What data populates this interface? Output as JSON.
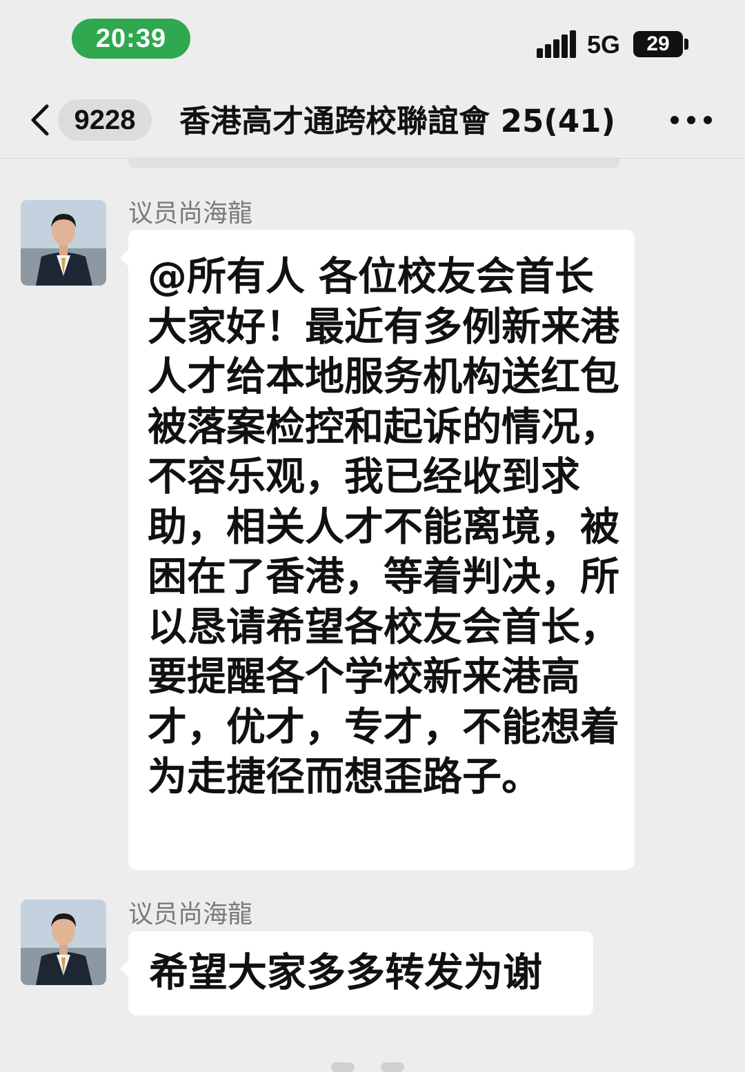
{
  "status_bar": {
    "time": "20:39",
    "network": "5G",
    "battery": "29"
  },
  "nav": {
    "unread_count": "9228",
    "title": "香港高才通跨校聯誼會 25(41)",
    "back_icon": "chevron-left-icon",
    "more_icon": "more-dots-icon"
  },
  "messages": [
    {
      "sender": "议员尚海龍",
      "text": "@所有人 各位校友会首长大家好！最近有多例新来港人才给本地服务机构送红包被落案检控和起诉的情况，不容乐观，我已经收到求助，相关人才不能离境，被困在了香港，等着判决，所以恳请希望各校友会首长，要提醒各个学校新来港高才，优才，专才，不能想着为走捷径而想歪路子。"
    },
    {
      "sender": "议员尚海龍",
      "text": "希望大家多多转发为谢"
    }
  ],
  "colors": {
    "background": "#ededed",
    "bubble": "#ffffff",
    "time_pill": "#2fa84f",
    "sender_name": "#7a7a7a"
  }
}
